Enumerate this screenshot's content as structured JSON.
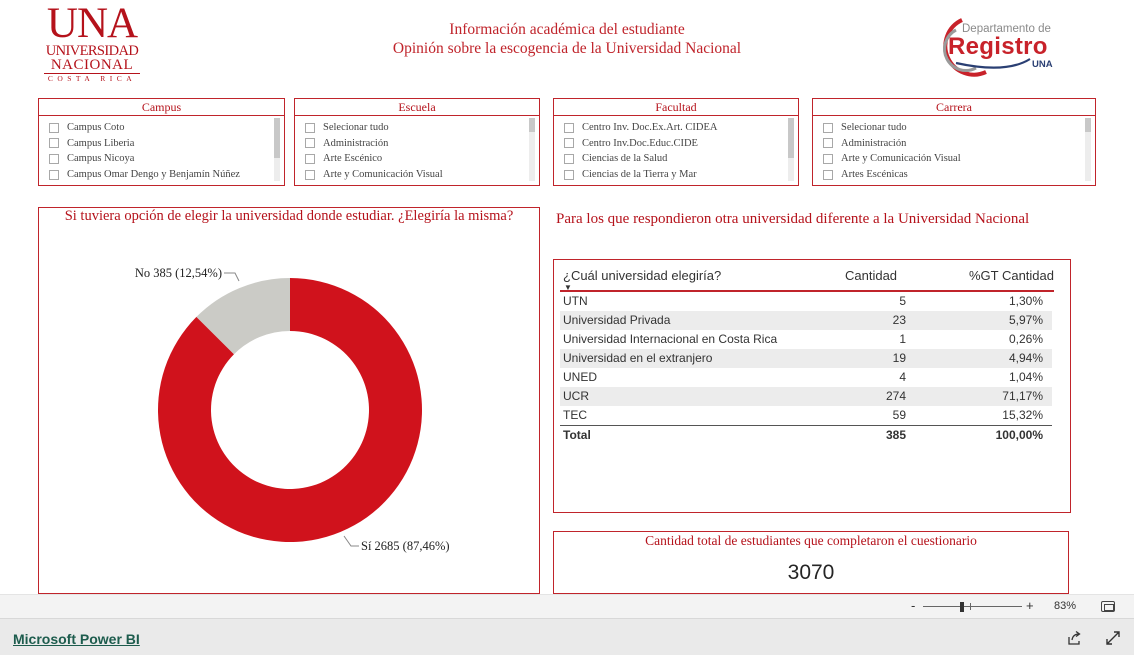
{
  "header": {
    "logo_una": {
      "big": "UNA",
      "line1": "UNIVERSIDAD",
      "line2": "NACIONAL",
      "line3": "COSTA RICA"
    },
    "title_line1": "Información académica del estudiante",
    "title_line2": "Opinión sobre la escogencia de la Universidad Nacional",
    "logo_registro": {
      "top": "Departamento de",
      "main": "Registro",
      "sub": "UNA"
    }
  },
  "slicers": [
    {
      "title": "Campus",
      "items": [
        "Campus Coto",
        "Campus Liberia",
        "Campus Nicoya",
        "Campus Omar Dengo y Benjamín Núñez"
      ]
    },
    {
      "title": "Escuela",
      "items": [
        "Selecionar tudo",
        "Administración",
        "Arte Escénico",
        "Arte y Comunicación Visual"
      ]
    },
    {
      "title": "Facultad",
      "items": [
        "Centro Inv. Doc.Ex.Art. CIDEA",
        "Centro Inv.Doc.Educ.CIDE",
        "Ciencias de la Salud",
        "Ciencias de la Tierra y Mar"
      ]
    },
    {
      "title": "Carrera",
      "items": [
        "Selecionar tudo",
        "Administración",
        "Arte y Comunicación Visual",
        "Artes Escénicas"
      ]
    }
  ],
  "donut": {
    "title": "Si tuviera opción de elegir la universidad donde estudiar. ¿Elegiría la misma?",
    "label_no": "No 385 (12,54%)",
    "label_si": "Sí 2685 (87,46%)"
  },
  "chart_data": {
    "type": "pie",
    "title": "Si tuviera opción de elegir la universidad donde estudiar. ¿Elegiría la misma?",
    "categories": [
      "Sí",
      "No"
    ],
    "values": [
      2685,
      385
    ],
    "percentages": [
      87.46,
      12.54
    ],
    "colors": [
      "#d0121c",
      "#cbcbc6"
    ],
    "donut": true
  },
  "right_heading": "Para los que respondieron otra universidad diferente a la Universidad Nacional",
  "table": {
    "headers": [
      "¿Cuál universidad elegiría?",
      "Cantidad",
      "%GT Cantidad"
    ],
    "rows": [
      [
        "UTN",
        "5",
        "1,30%"
      ],
      [
        "Universidad Privada",
        "23",
        "5,97%"
      ],
      [
        "Universidad Internacional en Costa Rica",
        "1",
        "0,26%"
      ],
      [
        "Universidad en el extranjero",
        "19",
        "4,94%"
      ],
      [
        "UNED",
        "4",
        "1,04%"
      ],
      [
        "UCR",
        "274",
        "71,17%"
      ],
      [
        "TEC",
        "59",
        "15,32%"
      ]
    ],
    "total": [
      "Total",
      "385",
      "100,00%"
    ]
  },
  "card": {
    "title": "Cantidad total de estudiantes que completaron el cuestionario",
    "value": "3070"
  },
  "zoom": {
    "minus": "-",
    "plus": "+",
    "level": "83%"
  },
  "footer": {
    "link": "Microsoft Power BI"
  },
  "colors": {
    "accent": "#c0242b",
    "si": "#d0121c",
    "no": "#cbcbc6"
  }
}
